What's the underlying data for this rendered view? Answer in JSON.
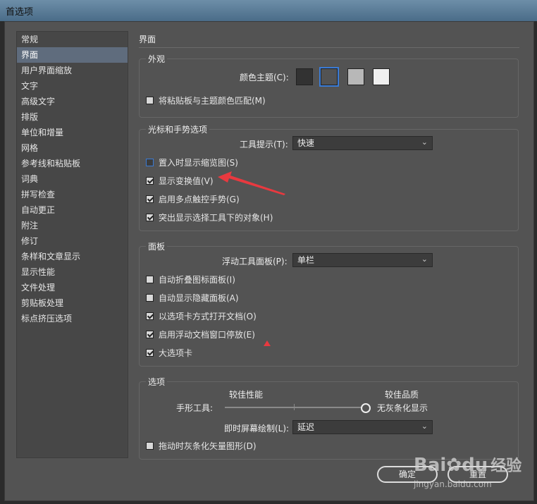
{
  "window": {
    "title": "首选项"
  },
  "sidebar": {
    "items": [
      {
        "label": "常规"
      },
      {
        "label": "界面"
      },
      {
        "label": "用户界面缩放"
      },
      {
        "label": "文字"
      },
      {
        "label": "高级文字"
      },
      {
        "label": "排版"
      },
      {
        "label": "单位和增量"
      },
      {
        "label": "网格"
      },
      {
        "label": "参考线和粘贴板"
      },
      {
        "label": "词典"
      },
      {
        "label": "拼写检查"
      },
      {
        "label": "自动更正"
      },
      {
        "label": "附注"
      },
      {
        "label": "修订"
      },
      {
        "label": "条样和文章显示"
      },
      {
        "label": "显示性能"
      },
      {
        "label": "文件处理"
      },
      {
        "label": "剪贴板处理"
      },
      {
        "label": "标点挤压选项"
      }
    ],
    "selected_index": 1
  },
  "page": {
    "title": "界面"
  },
  "appearance": {
    "title": "外观",
    "color_theme_label": "颜色主题(C):",
    "swatches": [
      "#323232",
      "#535353",
      "#b8b8b8",
      "#f0f0f0"
    ],
    "selected_swatch": 1,
    "match_pasteboard": {
      "label": "将粘贴板与主题颜色匹配(M)",
      "checked": false
    }
  },
  "cursor": {
    "title": "光标和手势选项",
    "tooltips_label": "工具提示(T):",
    "tooltips_value": "快速",
    "options": [
      {
        "label": "置入时显示缩览图(S)",
        "checked": false
      },
      {
        "label": "显示变换值(V)",
        "checked": true
      },
      {
        "label": "启用多点触控手势(G)",
        "checked": true
      },
      {
        "label": "突出显示选择工具下的对象(H)",
        "checked": true
      }
    ]
  },
  "panels": {
    "title": "面板",
    "floating_label": "浮动工具面板(P):",
    "floating_value": "单栏",
    "options": [
      {
        "label": "自动折叠图标面板(I)",
        "checked": false
      },
      {
        "label": "自动显示隐藏面板(A)",
        "checked": false
      },
      {
        "label": "以选项卡方式打开文档(O)",
        "checked": true
      },
      {
        "label": "启用浮动文档窗口停放(E)",
        "checked": true
      },
      {
        "label": "大选项卡",
        "checked": true
      }
    ]
  },
  "options": {
    "title": "选项",
    "better_perf": "较佳性能",
    "better_quality": "较佳品质",
    "hand_tool_label": "手形工具:",
    "slider_value_label": "无灰条化显示",
    "slider_position": 1.0,
    "live_draw_label": "即时屏幕绘制(L):",
    "live_draw_value": "延迟",
    "greek_vector": {
      "label": "拖动时灰条化矢量图形(D)",
      "checked": false
    }
  },
  "buttons": {
    "ok": "确定",
    "reset": "重置"
  },
  "watermark": {
    "brand": "Bai",
    "paw": "du",
    "cn": "经验",
    "url": "jingyan.baidu.com"
  },
  "colors": {
    "accent": "#3a7bd5",
    "annotation": "#e8393f"
  }
}
